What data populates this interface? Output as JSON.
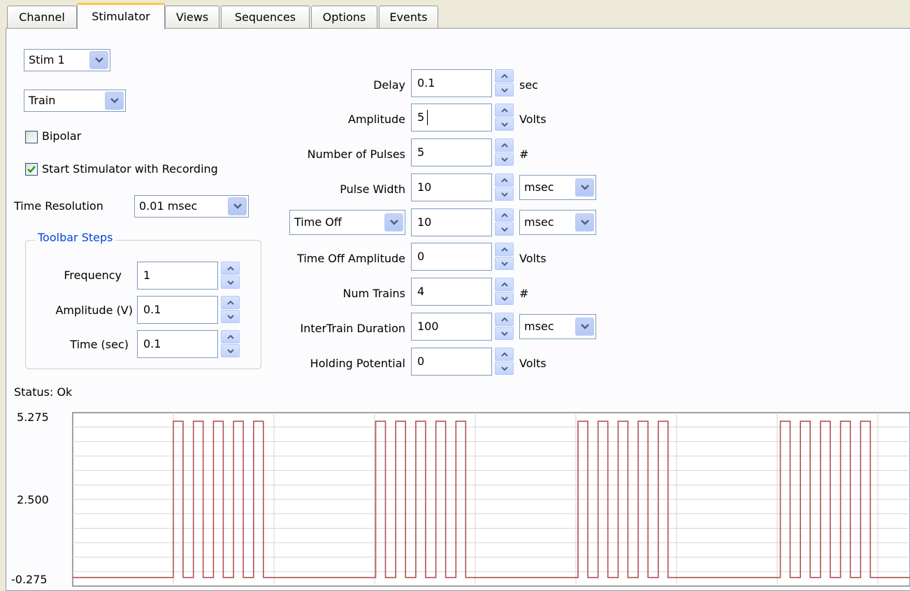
{
  "tabs": [
    {
      "label": "Channel",
      "active": false
    },
    {
      "label": "Stimulator",
      "active": true
    },
    {
      "label": "Views",
      "active": false
    },
    {
      "label": "Sequences",
      "active": false
    },
    {
      "label": "Options",
      "active": false
    },
    {
      "label": "Events",
      "active": false
    }
  ],
  "left": {
    "stim_select": "Stim 1",
    "mode_select": "Train",
    "bipolar_label": "Bipolar",
    "bipolar_checked": false,
    "start_label": "Start Stimulator with Recording",
    "start_checked": true,
    "time_res_label": "Time Resolution",
    "time_res_value": "0.01 msec",
    "toolbar": {
      "title": "Toolbar Steps",
      "frequency_label": "Frequency",
      "frequency_value": "1",
      "amplitude_label": "Amplitude (V)",
      "amplitude_value": "0.1",
      "time_label": "Time (sec)",
      "time_value": "0.1"
    }
  },
  "params": {
    "delay": {
      "label": "Delay",
      "value": "0.1",
      "unit": "sec"
    },
    "amplitude": {
      "label": "Amplitude",
      "value": "5",
      "unit": "Volts"
    },
    "num_pulses": {
      "label": "Number of Pulses",
      "value": "5",
      "unit": "#"
    },
    "pulse_width": {
      "label": "Pulse Width",
      "value": "10",
      "unit": "msec"
    },
    "time_off": {
      "label": "Time Off",
      "value": "10",
      "unit": "msec"
    },
    "time_off_amp": {
      "label": "Time Off Amplitude",
      "value": "0",
      "unit": "Volts"
    },
    "num_trains": {
      "label": "Num Trains",
      "value": "4",
      "unit": "#"
    },
    "intertrain": {
      "label": "InterTrain Duration",
      "value": "100",
      "unit": "msec"
    },
    "holding": {
      "label": "Holding Potential",
      "value": "0",
      "unit": "Volts"
    }
  },
  "status": "Status: Ok",
  "chart_data": {
    "type": "line",
    "title": "",
    "ylim": [
      -0.275,
      5.275
    ],
    "ytick_labels": [
      "5.275",
      "2.500",
      "-0.275"
    ],
    "grid": true,
    "series": [
      {
        "color": "#b05050"
      }
    ],
    "trains": 4,
    "pulses_per_train": 5,
    "pulse_high": 5,
    "baseline": 0
  },
  "colors": {
    "accent": "#ffc83c",
    "trace": "#b05050",
    "group_title": "#0046d5"
  }
}
